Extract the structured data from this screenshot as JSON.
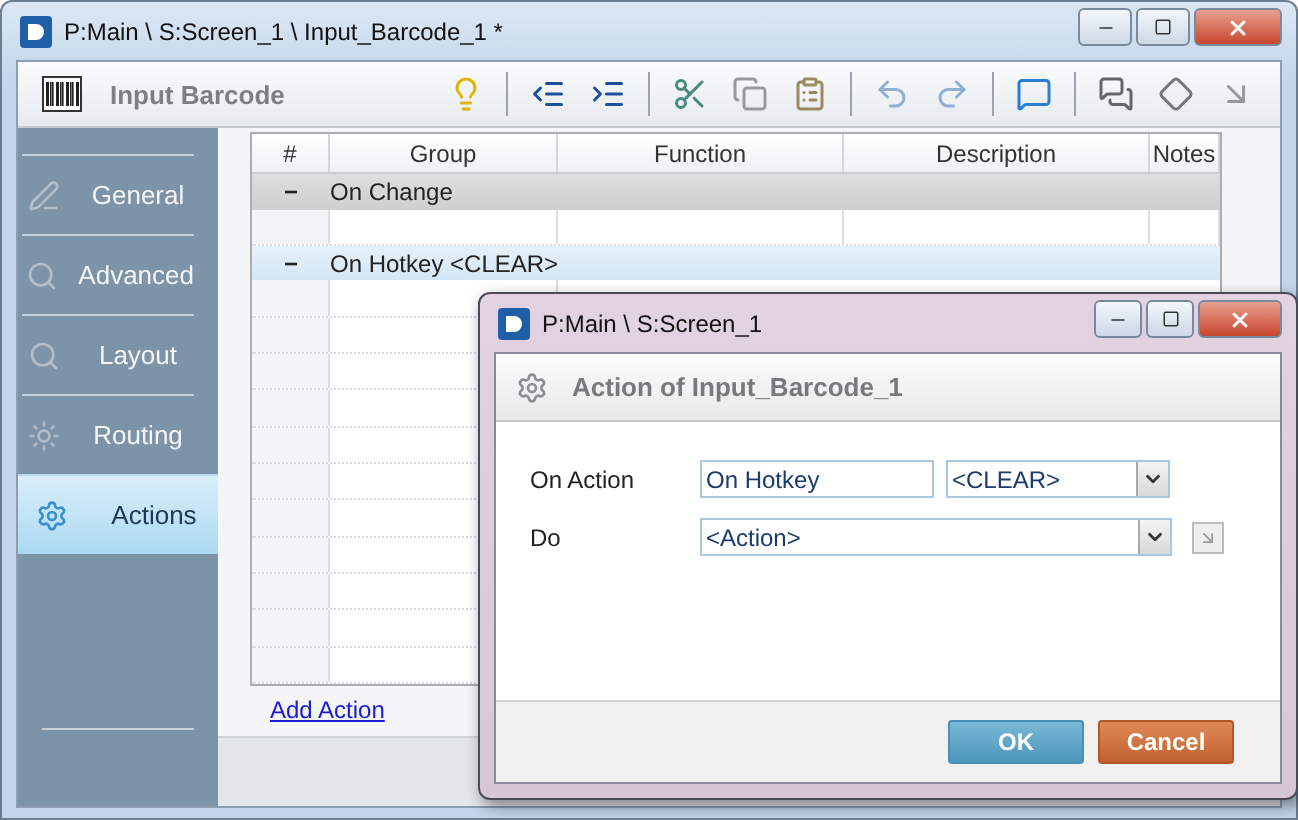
{
  "window": {
    "title": "P:Main \\ S:Screen_1 \\ Input_Barcode_1 *"
  },
  "toolbar": {
    "title": "Input Barcode"
  },
  "sidebar": {
    "items": [
      {
        "label": "General",
        "selected": false
      },
      {
        "label": "Advanced",
        "selected": false
      },
      {
        "label": "Layout",
        "selected": false
      },
      {
        "label": "Routing",
        "selected": false
      },
      {
        "label": "Actions",
        "selected": true
      }
    ]
  },
  "table": {
    "columns": [
      "#",
      "Group",
      "Function",
      "Description",
      "Notes"
    ],
    "groups": [
      {
        "toggle": "−",
        "name": "On Change",
        "selected": false
      },
      {
        "toggle": "−",
        "name": "On Hotkey <CLEAR>",
        "selected": true
      }
    ]
  },
  "add_action": "Add Action",
  "dialog": {
    "title": "P:Main \\ S:Screen_1",
    "heading": "Action of Input_Barcode_1",
    "fields": [
      {
        "label": "On Action",
        "value": "On Hotkey",
        "select": "<CLEAR>"
      },
      {
        "label": "Do",
        "select": "<Action>"
      }
    ],
    "buttons": [
      {
        "label": "OK",
        "kind": "primary"
      },
      {
        "label": "Cancel",
        "kind": "cancel"
      }
    ]
  }
}
